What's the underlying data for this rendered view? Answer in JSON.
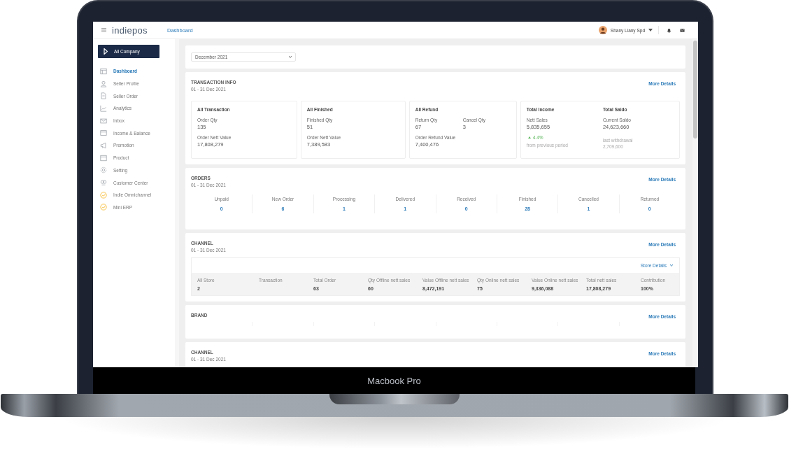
{
  "topbar": {
    "logo": "indiepos",
    "page_title": "Dashboard",
    "user": {
      "name": "Shany Liany Spd"
    }
  },
  "sidebar": {
    "company_button": "All Company",
    "items": [
      {
        "label": "Dashboard",
        "selected": true
      },
      {
        "label": "Seller Profile",
        "selected": false
      },
      {
        "label": "Seller Order",
        "selected": false
      },
      {
        "label": "Analytics",
        "selected": false
      },
      {
        "label": "Inbox",
        "selected": false
      },
      {
        "label": "Income & Balance",
        "selected": false
      },
      {
        "label": "Promotion",
        "selected": false
      },
      {
        "label": "Product",
        "selected": false
      },
      {
        "label": "Setting",
        "selected": false
      },
      {
        "label": "Customer Center",
        "selected": false
      },
      {
        "label": "Indie Omnichannel",
        "selected": false
      },
      {
        "label": "Mini ERP",
        "selected": false
      }
    ]
  },
  "period_select": {
    "value": "December 2021"
  },
  "transaction_info": {
    "title": "TRANSACTION INFO",
    "period": "01 - 31 Dec 2021",
    "link": "More Details",
    "cards": [
      {
        "columns": [
          {
            "title": "All Transaction",
            "rows": [
              [
                {
                  "label": "Order Qty",
                  "value": "135"
                }
              ],
              [
                {
                  "label": "Order Nett Value",
                  "value": "17,808,279"
                }
              ]
            ]
          }
        ]
      },
      {
        "columns": [
          {
            "title": "All Finished",
            "rows": [
              [
                {
                  "label": "Finished Qty",
                  "value": "51"
                }
              ],
              [
                {
                  "label": "Order Nett Value",
                  "value": "7,389,583"
                }
              ]
            ]
          }
        ]
      },
      {
        "columns": [
          {
            "title": "All Refund",
            "rows": [
              [
                {
                  "label": "Return Qty",
                  "value": "67"
                },
                {
                  "label": "Cancel Qty",
                  "value": "3"
                }
              ],
              [
                {
                  "label": "Order Refund Value",
                  "value": "7,400,476"
                }
              ]
            ]
          }
        ]
      },
      {
        "columns": [
          {
            "title": "Total Income",
            "rows": [
              [
                {
                  "label": "Nett Sales",
                  "value": "5,835,655"
                }
              ]
            ],
            "extra": {
              "kind": "trend",
              "value": "4.4%",
              "caption": "from previous period"
            }
          },
          {
            "title": "Total Saldo",
            "rows": [
              [
                {
                  "label": "Current Saldo",
                  "value": "24,623,660"
                }
              ]
            ],
            "extra": {
              "kind": "footnote",
              "caption": "last withdrawal",
              "value": "2,709,600"
            }
          }
        ]
      }
    ]
  },
  "orders": {
    "title": "ORDERS",
    "period": "01 - 31 Dec 2021",
    "link": "More Details",
    "statuses": [
      {
        "label": "Unpaid",
        "count": "0"
      },
      {
        "label": "New Order",
        "count": "6"
      },
      {
        "label": "Processing",
        "count": "1"
      },
      {
        "label": "Delivered",
        "count": "1"
      },
      {
        "label": "Received",
        "count": "0"
      },
      {
        "label": "Finished",
        "count": "28"
      },
      {
        "label": "Cancelled",
        "count": "1"
      },
      {
        "label": "Returned",
        "count": "0"
      }
    ]
  },
  "channel": {
    "title": "CHANNEL",
    "period": "01 - 31 Dec 2021",
    "link": "More Details",
    "store_details": "Store Details",
    "columns": [
      {
        "label": "All Store",
        "value": "2"
      },
      {
        "label": "Transaction"
      },
      {
        "label": "Total Order",
        "value": "63"
      },
      {
        "label": "Qty Offline nett sales",
        "value": "60"
      },
      {
        "label": "Value Offline nett sales",
        "value": "8,472,191"
      },
      {
        "label": "Qty Online nett sales",
        "value": "75"
      },
      {
        "label": "Value Online nett sales",
        "value": "9,336,088"
      },
      {
        "label": "Total nett sales",
        "value": "17,808,279"
      },
      {
        "label": "Contribution",
        "value": "100%"
      }
    ]
  },
  "brand": {
    "title": "BRAND",
    "link": "More Details"
  },
  "channel_2": {
    "title": "CHANNEL",
    "period": "01 - 31 Dec 2021",
    "link": "More Details"
  },
  "device": {
    "label": "Macbook Pro"
  }
}
